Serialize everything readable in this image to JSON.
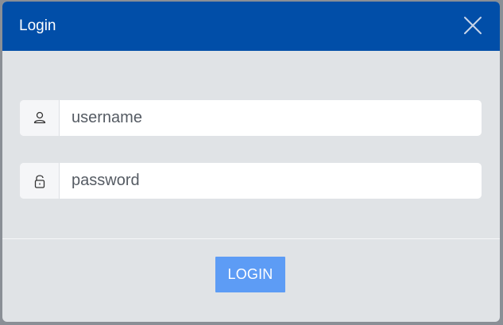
{
  "dialog": {
    "title": "Login",
    "close_icon": "close-icon"
  },
  "form": {
    "username": {
      "icon": "user-icon",
      "placeholder": "username",
      "value": ""
    },
    "password": {
      "icon": "lock-icon",
      "placeholder": "password",
      "value": ""
    }
  },
  "actions": {
    "login_label": "LOGIN"
  },
  "colors": {
    "header": "#014ea8",
    "body": "#e0e3e6",
    "button": "#5d9cf5"
  }
}
